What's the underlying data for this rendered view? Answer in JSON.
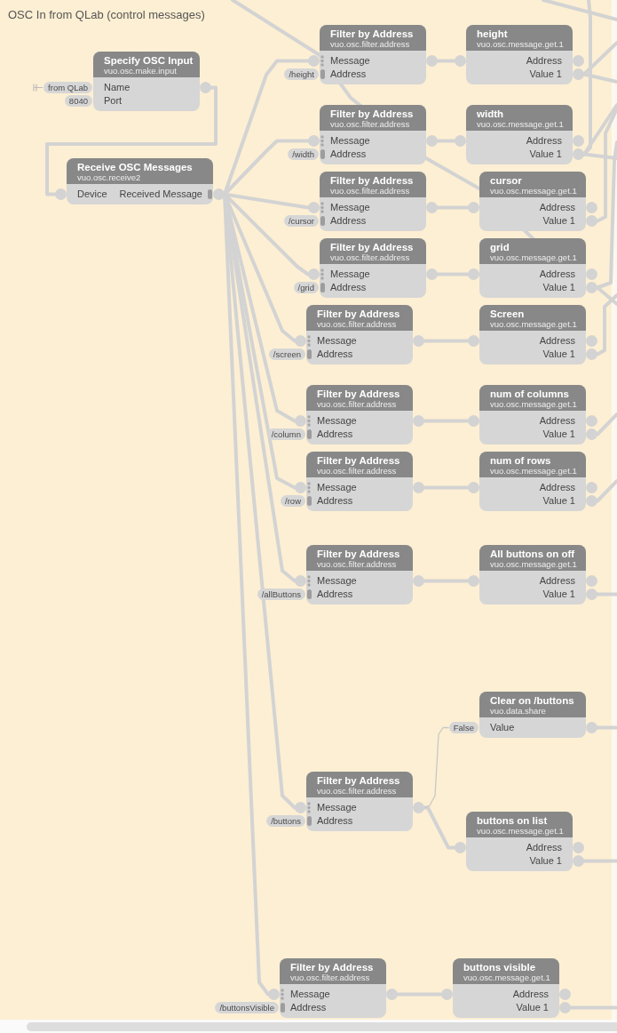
{
  "comment": {
    "title": "OSC In from QLab (control messages)"
  },
  "nodes": [
    {
      "title": "Specify OSC Input",
      "class_name": "vuo.osc.make.input",
      "rows": [
        {
          "input": {
            "label": "Name",
            "constant": "from QLab",
            "stub": true
          },
          "output": {
            "port": true
          }
        },
        {
          "input": {
            "label": "Port",
            "constant": "8040"
          }
        }
      ]
    },
    {
      "title": "Receive OSC Messages",
      "class_name": "vuo.osc.receive2",
      "rows": [
        {
          "input": {
            "label": "Device",
            "port": true
          },
          "output": {
            "label": "Received Message",
            "port": true,
            "handle": true
          }
        }
      ]
    },
    {
      "title": "Filter by Address",
      "class_name": "vuo.osc.filter.address",
      "rows": [
        {
          "input": {
            "label": "Message",
            "port": true,
            "dots": true
          },
          "output": {
            "port": true
          }
        },
        {
          "input": {
            "label": "Address",
            "handle": true,
            "constant": "/height"
          }
        }
      ]
    },
    {
      "title": "height",
      "class_name": "vuo.osc.message.get.1",
      "rows": [
        {
          "input": {
            "port": true
          },
          "output": {
            "label": "Address",
            "port": true
          }
        },
        {
          "output": {
            "label": "Value 1",
            "port": true
          }
        }
      ]
    },
    {
      "title": "Filter by Address",
      "class_name": "vuo.osc.filter.address",
      "rows": [
        {
          "input": {
            "label": "Message",
            "port": true,
            "dots": true
          },
          "output": {
            "port": true
          }
        },
        {
          "input": {
            "label": "Address",
            "handle": true,
            "constant": "/width"
          }
        }
      ]
    },
    {
      "title": "width",
      "class_name": "vuo.osc.message.get.1",
      "rows": [
        {
          "input": {
            "port": true
          },
          "output": {
            "label": "Address",
            "port": true
          }
        },
        {
          "output": {
            "label": "Value 1",
            "port": true
          }
        }
      ]
    },
    {
      "title": "Filter by Address",
      "class_name": "vuo.osc.filter.address",
      "rows": [
        {
          "input": {
            "label": "Message",
            "port": true,
            "dots": true
          },
          "output": {
            "port": true
          }
        },
        {
          "input": {
            "label": "Address",
            "handle": true,
            "constant": "/cursor"
          }
        }
      ]
    },
    {
      "title": "cursor",
      "class_name": "vuo.osc.message.get.1",
      "rows": [
        {
          "input": {
            "port": true
          },
          "output": {
            "label": "Address",
            "port": true
          }
        },
        {
          "output": {
            "label": "Value 1",
            "port": true
          }
        }
      ]
    },
    {
      "title": "Filter by Address",
      "class_name": "vuo.osc.filter.address",
      "rows": [
        {
          "input": {
            "label": "Message",
            "port": true,
            "dots": true
          },
          "output": {
            "port": true
          }
        },
        {
          "input": {
            "label": "Address",
            "handle": true,
            "constant": "/grid"
          }
        }
      ]
    },
    {
      "title": "grid",
      "class_name": "vuo.osc.message.get.1",
      "rows": [
        {
          "input": {
            "port": true
          },
          "output": {
            "label": "Address",
            "port": true
          }
        },
        {
          "output": {
            "label": "Value 1",
            "port": true
          }
        }
      ]
    },
    {
      "title": "Filter by Address",
      "class_name": "vuo.osc.filter.address",
      "rows": [
        {
          "input": {
            "label": "Message",
            "port": true,
            "dots": true
          },
          "output": {
            "port": true
          }
        },
        {
          "input": {
            "label": "Address",
            "handle": true,
            "constant": "/screen"
          }
        }
      ]
    },
    {
      "title": "Screen",
      "class_name": "vuo.osc.message.get.1",
      "rows": [
        {
          "input": {
            "port": true
          },
          "output": {
            "label": "Address",
            "port": true
          }
        },
        {
          "output": {
            "label": "Value 1",
            "port": true
          }
        }
      ]
    },
    {
      "title": "Filter by Address",
      "class_name": "vuo.osc.filter.address",
      "rows": [
        {
          "input": {
            "label": "Message",
            "port": true,
            "dots": true
          },
          "output": {
            "port": true
          }
        },
        {
          "input": {
            "label": "Address",
            "handle": true,
            "constant": "/column"
          }
        }
      ]
    },
    {
      "title": "num of columns",
      "class_name": "vuo.osc.message.get.1",
      "rows": [
        {
          "input": {
            "port": true
          },
          "output": {
            "label": "Address",
            "port": true
          }
        },
        {
          "output": {
            "label": "Value 1",
            "port": true
          }
        }
      ]
    },
    {
      "title": "Filter by Address",
      "class_name": "vuo.osc.filter.address",
      "rows": [
        {
          "input": {
            "label": "Message",
            "port": true,
            "dots": true
          },
          "output": {
            "port": true
          }
        },
        {
          "input": {
            "label": "Address",
            "handle": true,
            "constant": "/row"
          }
        }
      ]
    },
    {
      "title": "num of rows",
      "class_name": "vuo.osc.message.get.1",
      "rows": [
        {
          "input": {
            "port": true
          },
          "output": {
            "label": "Address",
            "port": true
          }
        },
        {
          "output": {
            "label": "Value 1",
            "port": true
          }
        }
      ]
    },
    {
      "title": "Filter by Address",
      "class_name": "vuo.osc.filter.address",
      "rows": [
        {
          "input": {
            "label": "Message",
            "port": true,
            "dots": true
          },
          "output": {
            "port": true
          }
        },
        {
          "input": {
            "label": "Address",
            "handle": true,
            "constant": "/allButtons"
          }
        }
      ]
    },
    {
      "title": "All buttons on off",
      "class_name": "vuo.osc.message.get.1",
      "rows": [
        {
          "input": {
            "port": true
          },
          "output": {
            "label": "Address",
            "port": true
          }
        },
        {
          "output": {
            "label": "Value 1",
            "port": true
          }
        }
      ]
    },
    {
      "title": "Clear on /buttons",
      "class_name": "vuo.data.share",
      "rows": [
        {
          "input": {
            "label": "Value",
            "constant": "False"
          },
          "output": {
            "port": true
          }
        }
      ]
    },
    {
      "title": "Filter by Address",
      "class_name": "vuo.osc.filter.address",
      "rows": [
        {
          "input": {
            "label": "Message",
            "port": true,
            "dots": true
          },
          "output": {
            "port": true
          }
        },
        {
          "input": {
            "label": "Address",
            "handle": true,
            "constant": "/buttons"
          }
        }
      ]
    },
    {
      "title": "buttons on list",
      "class_name": "vuo.osc.message.get.1",
      "rows": [
        {
          "input": {
            "port": true
          },
          "output": {
            "label": "Address",
            "port": true
          }
        },
        {
          "output": {
            "label": "Value 1",
            "port": true
          }
        }
      ]
    },
    {
      "title": "Filter by Address",
      "class_name": "vuo.osc.filter.address",
      "rows": [
        {
          "input": {
            "label": "Message",
            "port": true,
            "dots": true
          },
          "output": {
            "port": true
          }
        },
        {
          "input": {
            "label": "Address",
            "handle": true,
            "constant": "/buttonsVisible"
          }
        }
      ]
    },
    {
      "title": "buttons visible",
      "class_name": "vuo.osc.message.get.1",
      "rows": [
        {
          "input": {
            "port": true
          },
          "output": {
            "label": "Address",
            "port": true
          }
        },
        {
          "output": {
            "label": "Value 1",
            "port": true
          }
        }
      ]
    }
  ]
}
